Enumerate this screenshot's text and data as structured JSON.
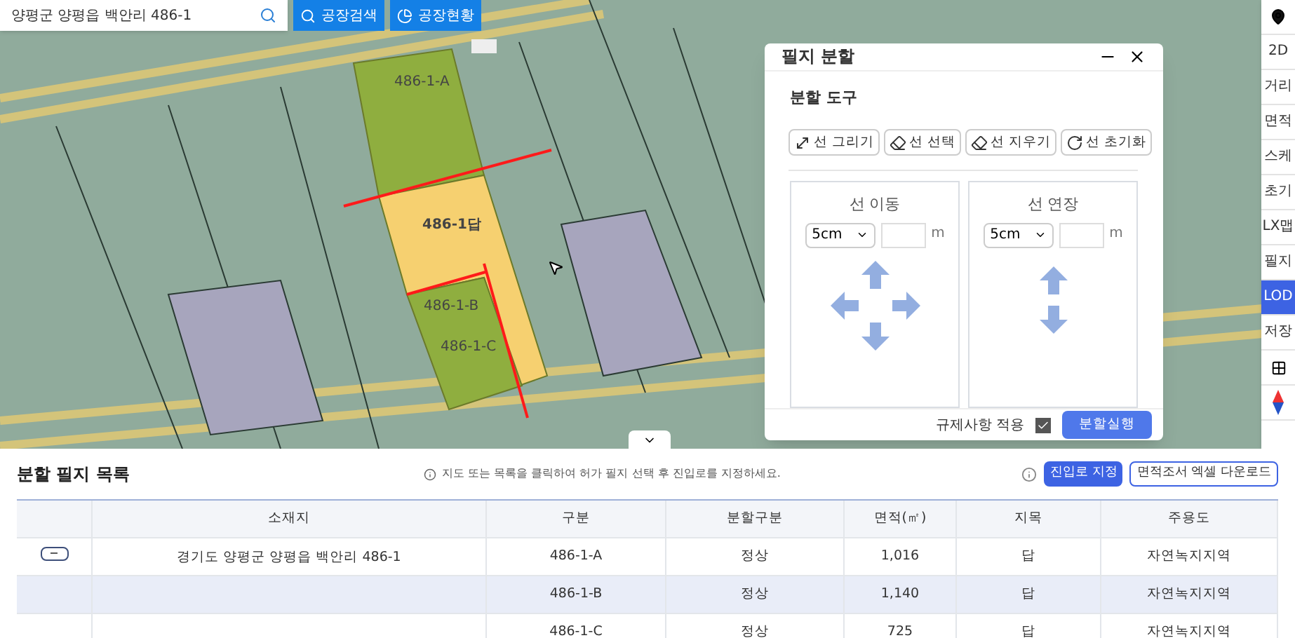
{
  "search": {
    "value": "양평군 양평읍 백안리 486-1"
  },
  "top_buttons": [
    {
      "kind": "search",
      "label": "공장검색"
    },
    {
      "kind": "chart",
      "label": "공장현황"
    }
  ],
  "map_labels": [
    {
      "text": "486-1-A"
    },
    {
      "text": "486-1답"
    },
    {
      "text": "486-1-B"
    },
    {
      "text": "486-1-C"
    }
  ],
  "toolbar": [
    {
      "kind": "pin"
    },
    {
      "kind": "text",
      "label": "2D"
    },
    {
      "kind": "text",
      "label": "거리"
    },
    {
      "kind": "text",
      "label": "면적"
    },
    {
      "kind": "text",
      "label": "스케"
    },
    {
      "kind": "text",
      "label": "초기"
    },
    {
      "kind": "text",
      "label": "LX맵"
    },
    {
      "kind": "text",
      "label": "필지"
    },
    {
      "kind": "active",
      "label": "LOD"
    },
    {
      "kind": "text",
      "label": "저장"
    },
    {
      "kind": "grid"
    },
    {
      "kind": "compass"
    }
  ],
  "dialog": {
    "title": "필지 분할",
    "section": "분할 도구",
    "tools": [
      {
        "kind": "draw",
        "label": "선 그리기"
      },
      {
        "kind": "select",
        "label": "선 선택"
      },
      {
        "kind": "erase",
        "label": "선 지우기"
      },
      {
        "kind": "reset",
        "label": "선 초기화"
      }
    ],
    "panels": [
      {
        "kind": "move",
        "title": "선 이동",
        "step": "5cm",
        "unit": "m"
      },
      {
        "kind": "extend",
        "title": "선 연장",
        "step": "5cm",
        "unit": "m"
      }
    ],
    "regulation": {
      "label": "규제사항 적용",
      "checked": true
    },
    "run_button": "분할실행"
  },
  "list": {
    "title": "분할 필지 목록",
    "hint": "지도 또는 목록을 클릭하여 허가 필지 선택 후 진입로를 지정하세요.",
    "buttons": [
      {
        "kind": "primary",
        "label": "진입로 지정"
      },
      {
        "kind": "outline",
        "label": "면적조서 엑셀 다운로드"
      }
    ],
    "columns": [
      "소재지",
      "구분",
      "분할구분",
      "면적(㎡)",
      "지목",
      "주용도"
    ],
    "rows": [
      {
        "toggle": "−",
        "selected": false,
        "cells": [
          "경기도 양평군 양평읍 백안리 486-1",
          "486-1-A",
          "정상",
          "1,016",
          "답",
          "자연녹지지역"
        ]
      },
      {
        "selected": true,
        "cells": [
          "",
          "486-1-B",
          "정상",
          "1,140",
          "답",
          "자연녹지지역"
        ]
      },
      {
        "selected": false,
        "cells": [
          "",
          "486-1-C",
          "정상",
          "725",
          "답",
          "자연녹지지역"
        ]
      }
    ]
  }
}
